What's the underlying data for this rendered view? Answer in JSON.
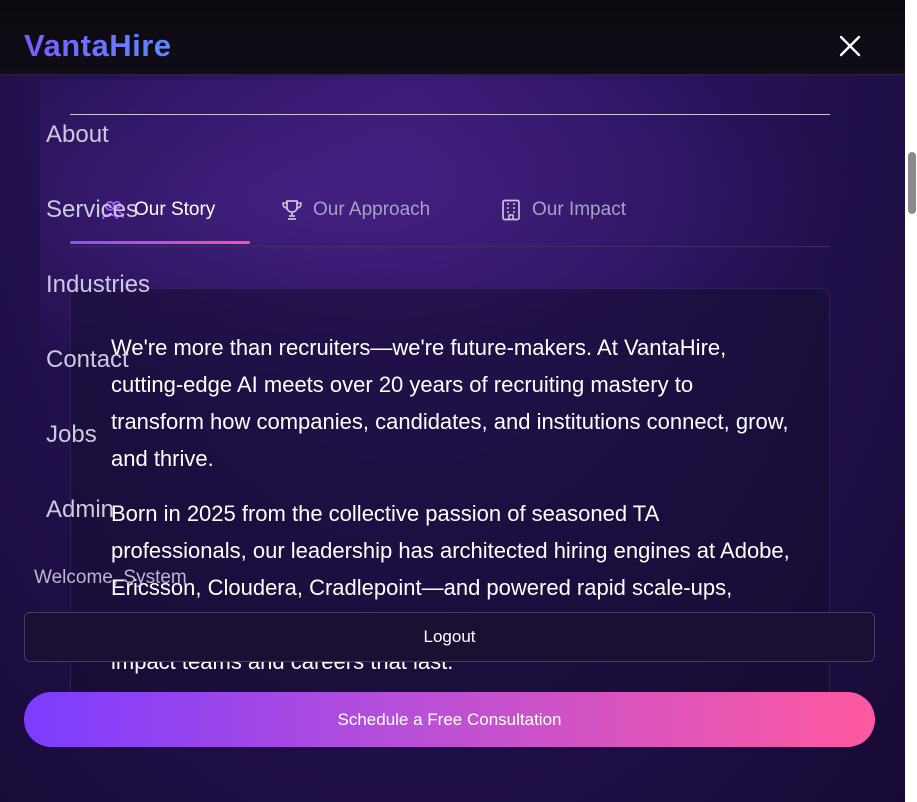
{
  "header": {
    "logo": "VantaHire",
    "close_icon": "close-icon"
  },
  "tabs": [
    {
      "label": "Our Story",
      "icon": "users-icon",
      "active": true
    },
    {
      "label": "Our Approach",
      "icon": "trophy-icon",
      "active": false
    },
    {
      "label": "Our Impact",
      "icon": "building-icon",
      "active": false
    }
  ],
  "content": {
    "paragraph1": "We're more than recruiters—we're future-makers. At VantaHire, cutting-edge AI meets over 20 years of recruiting mastery to transform how companies, candidates, and institutions connect, grow, and thrive.",
    "paragraph2": "Born in 2025 from the collective passion of seasoned TA professionals, our leadership has architected hiring engines at Adobe, Ericsson, Cloudera, Cradlepoint—and powered rapid scale-ups, Global Capability Centers, and bootstrapped startups building high-impact teams and careers that last."
  },
  "menu": {
    "items": [
      "About",
      "Services",
      "Industries",
      "Contact",
      "Jobs",
      "Admin"
    ],
    "welcome": "Welcome, System",
    "logout_label": "Logout",
    "cta_label": "Schedule a Free Consultation"
  },
  "colors": {
    "accent_purple": "#7c3cff",
    "accent_pink": "#ff59a0",
    "logo_gradient_start": "#7b5cff",
    "logo_gradient_end": "#5b8bff"
  }
}
